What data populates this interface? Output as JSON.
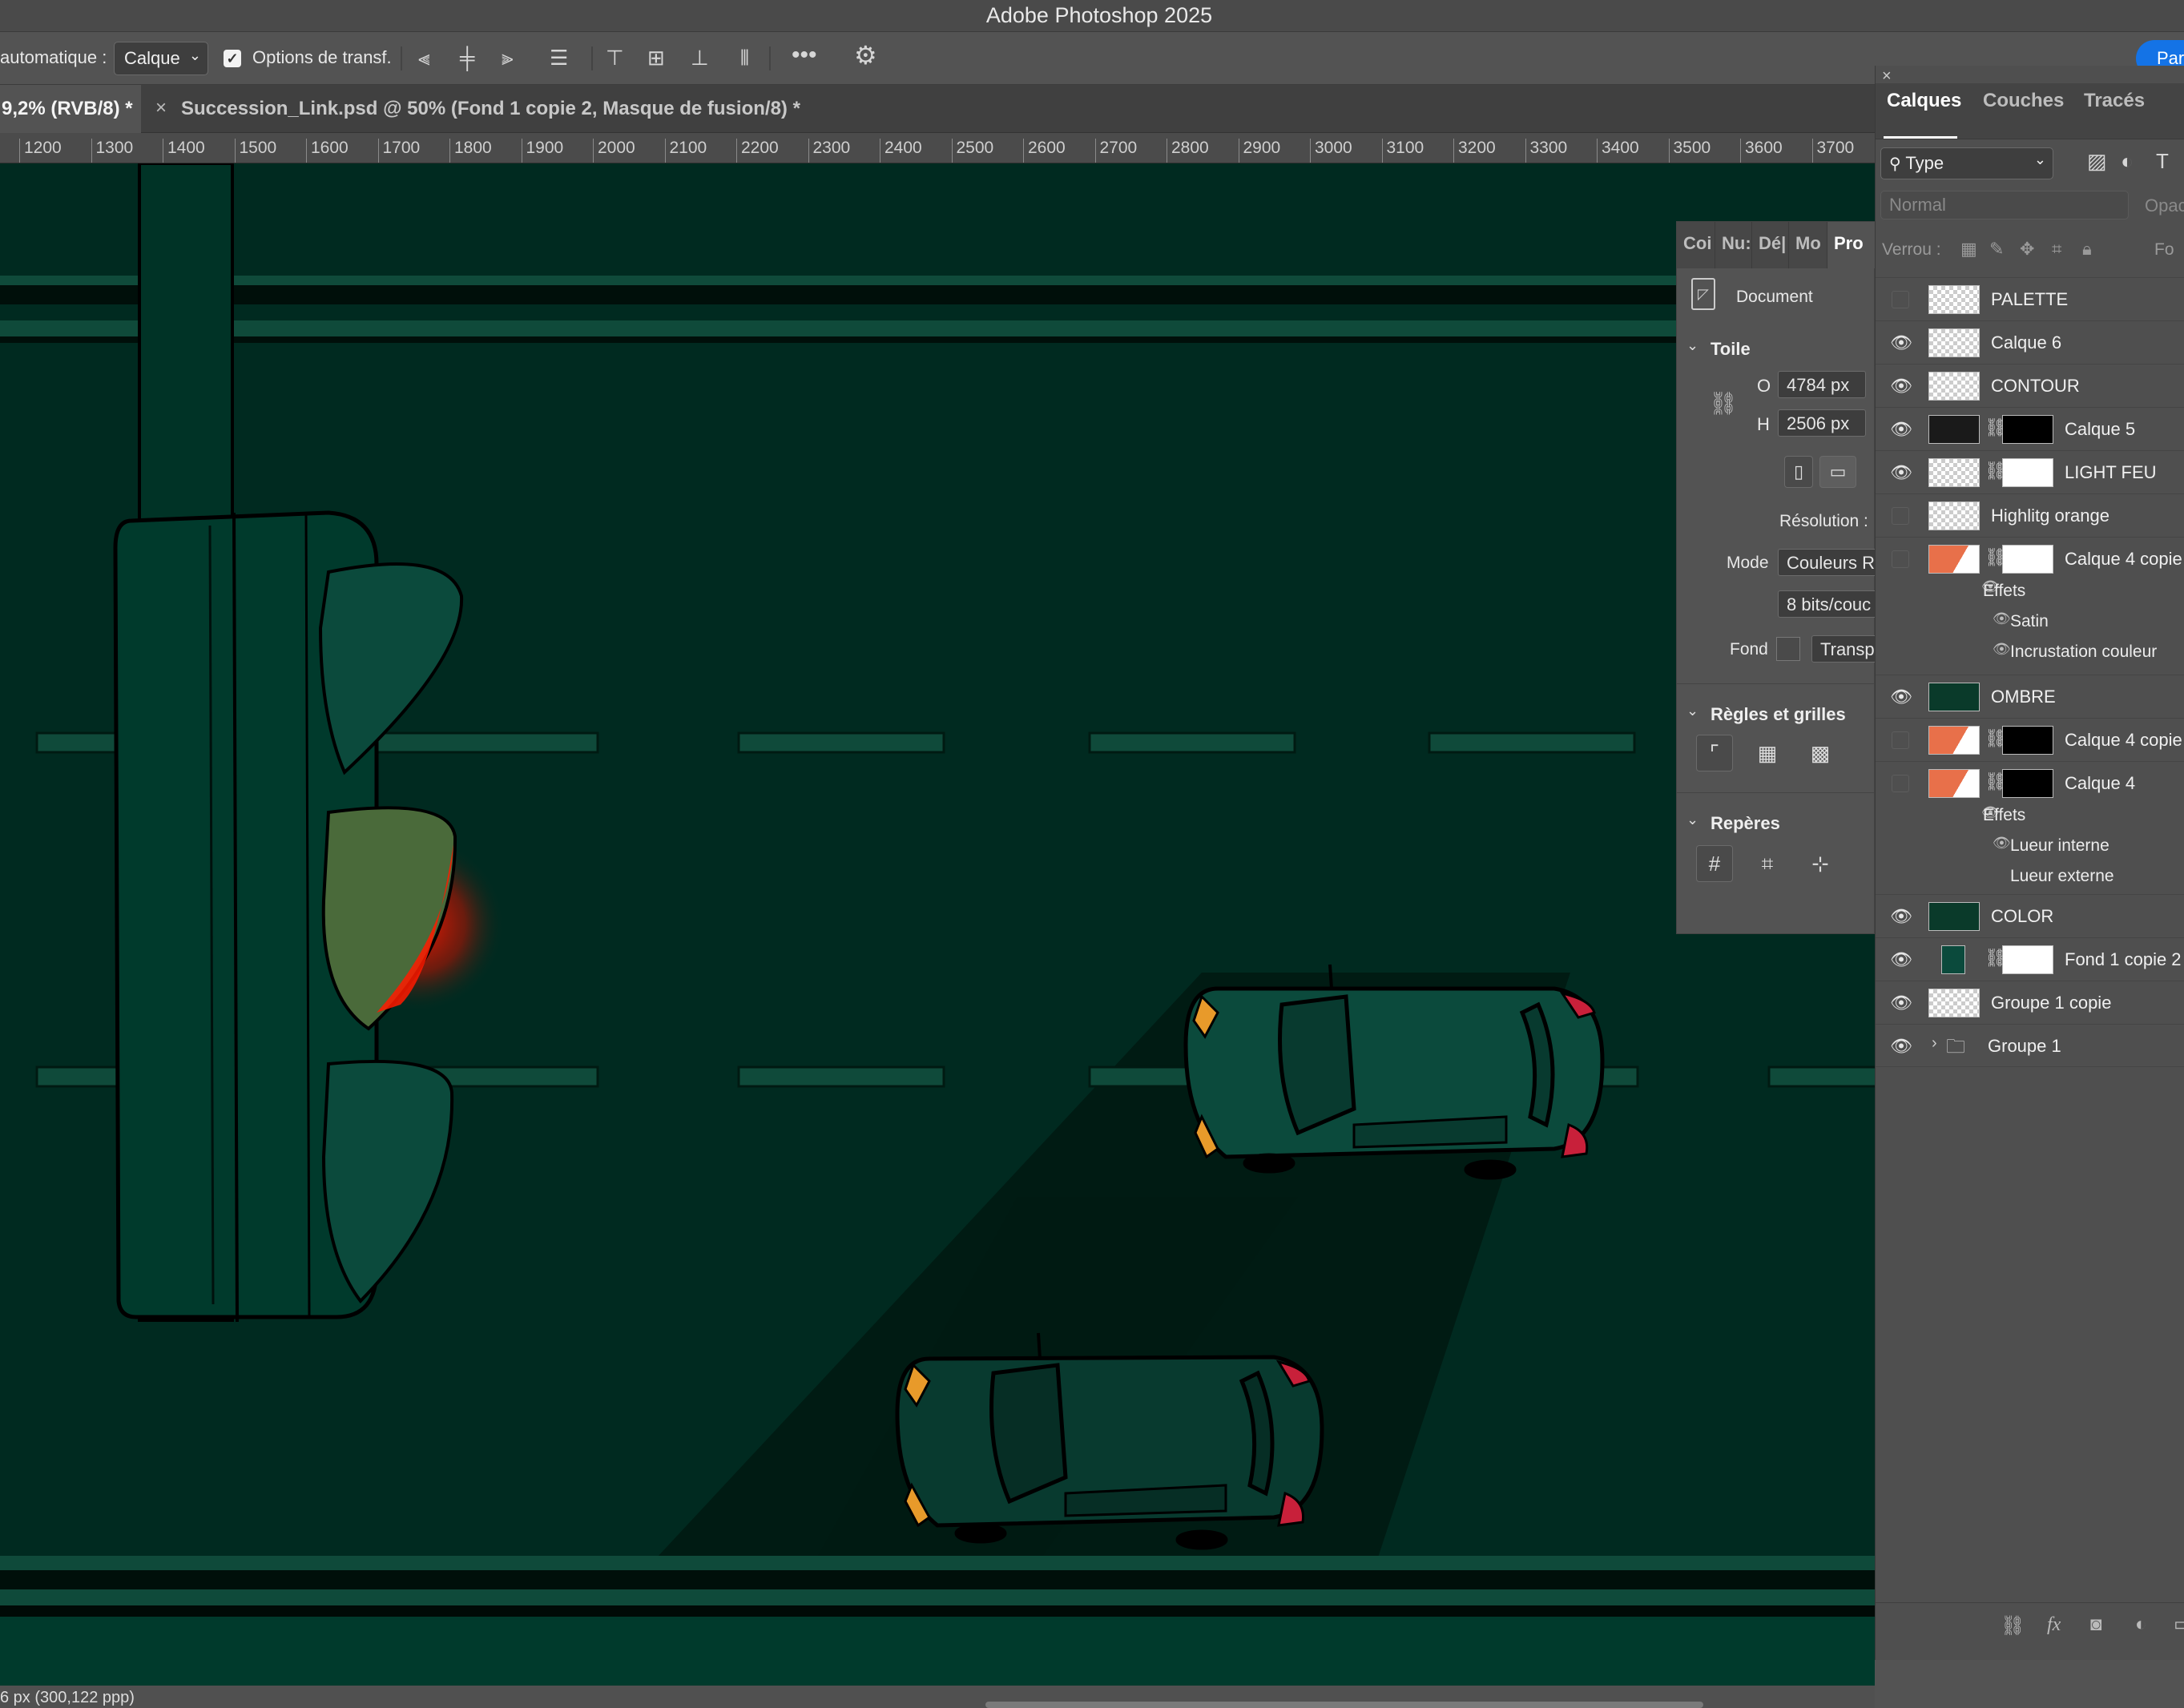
{
  "app": {
    "title": "Adobe Photoshop 2025"
  },
  "options_bar": {
    "auto_select_label": "automatique :",
    "auto_select_value": "Calque",
    "transform_label": "Options de transf.",
    "share_button": "Par"
  },
  "tabs": [
    {
      "label": "9,2% (RVB/8) *"
    },
    {
      "label": "Succession_Link.psd @ 50% (Fond 1 copie 2, Masque de fusion/8) *"
    }
  ],
  "ruler": {
    "ticks": [
      "1200",
      "1300",
      "1400",
      "1500",
      "1600",
      "1700",
      "1800",
      "1900",
      "2000",
      "2100",
      "2200",
      "2300",
      "2400",
      "2500",
      "2600",
      "2700",
      "2800",
      "2900",
      "3000",
      "3100",
      "3200",
      "3300",
      "3400",
      "3500",
      "3600",
      "3700"
    ]
  },
  "status_bar": {
    "text": "6 px (300,122 ppp)"
  },
  "properties": {
    "tabs": [
      "Coi",
      "Nu:",
      "Dé|",
      "Mo",
      "Pro"
    ],
    "document_label": "Document",
    "canvas": {
      "title": "Toile",
      "w_label": "O",
      "w_value": "4784 px",
      "h_label": "H",
      "h_value": "2506 px"
    },
    "resolution_label": "Résolution :",
    "mode_label": "Mode",
    "mode_value": "Couleurs R",
    "depth_value": "8 bits/couc",
    "background_label": "Fond",
    "background_value": "Transp",
    "rulers_title": "Règles et grilles",
    "guides_title": "Repères"
  },
  "layers_panel": {
    "tabs": [
      "Calques",
      "Couches",
      "Tracés"
    ],
    "filter_value": "Type",
    "blend_mode": "Normal",
    "opacity_label": "Opac",
    "lock_label": "Verrou :",
    "fill_label": "Fo",
    "layers": [
      {
        "name": "PALETTE"
      },
      {
        "name": "Calque 6"
      },
      {
        "name": "CONTOUR"
      },
      {
        "name": "Calque 5"
      },
      {
        "name": "LIGHT FEU"
      },
      {
        "name": "Highlitg orange"
      },
      {
        "name": "Calque 4 copie"
      },
      {
        "name": "OMBRE"
      },
      {
        "name": "Calque 4 copie"
      },
      {
        "name": "Calque 4"
      },
      {
        "name": "COLOR"
      },
      {
        "name": "Fond 1 copie 2"
      },
      {
        "name": "Groupe 1 copie"
      },
      {
        "name": "Groupe 1"
      }
    ],
    "effects_label": "Effets",
    "effects_a": [
      "Satin",
      "Incrustation couleur"
    ],
    "effects_b": [
      "Lueur interne",
      "Lueur externe"
    ]
  },
  "colors": {
    "canvas_bg": "#002a20",
    "road_stripe": "#0f4a3a",
    "car_body": "#0b4a3c",
    "accent": "#1473e6"
  }
}
